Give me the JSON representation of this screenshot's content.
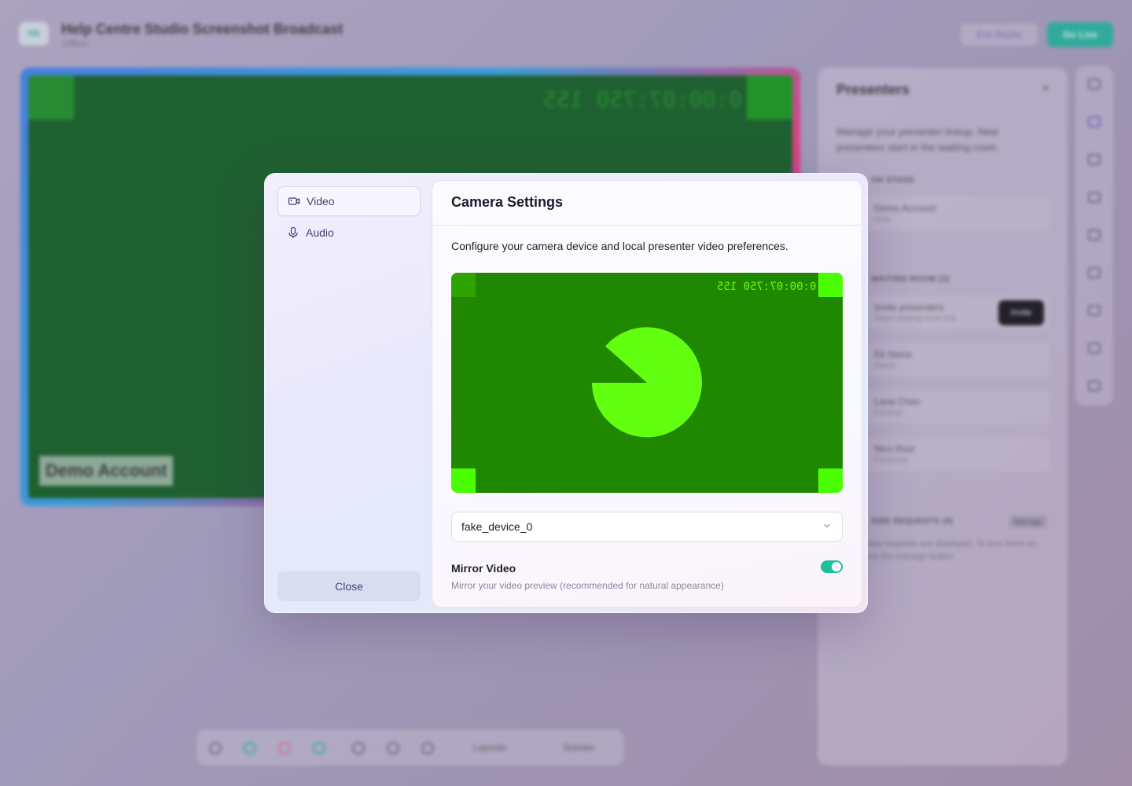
{
  "background": {
    "logo_text": "HS",
    "title": "Help Centre Studio Screenshot Broadcast",
    "subtitle": "Offline",
    "exit_label": "Exit Studio",
    "golive_label": "Go Live",
    "stage_time": "0:00:07:750 155",
    "stage_name": "Demo Account",
    "panel": {
      "title": "Presenters",
      "description": "Manage your presenter lineup. New presenters start in the waiting room.",
      "on_stage_label": "ON STAGE",
      "on_stage_row": {
        "name": "Demo Account",
        "sub": "Host"
      },
      "waiting_label": "WAITING ROOM (3)",
      "invite_row": {
        "name": "Invite presenters",
        "sub": "Share waiting room link"
      },
      "invite_button": "Invite",
      "waiting_rows": [
        {
          "name": "Eli Stone",
          "sub": "Guest"
        },
        {
          "name": "Lana Chen",
          "sub": "Co-host"
        },
        {
          "name": "Nico Ruiz",
          "sub": "Presenter"
        }
      ],
      "requests_label": "SIDE REQUESTS (0)",
      "manage_label": "Manage",
      "requests_note": "New requests are displayed. To turn them on, use the manage button."
    },
    "toolbar": {
      "layouts_label": "Layouts",
      "scenes_label": "Scenes"
    }
  },
  "modal": {
    "nav": [
      {
        "label": "Video",
        "icon": "video-camera-icon",
        "active": true
      },
      {
        "label": "Audio",
        "icon": "microphone-icon",
        "active": false
      }
    ],
    "close_label": "Close",
    "title": "Camera Settings",
    "description": "Configure your camera device and local presenter video preferences.",
    "preview": {
      "timecode": "0:00:07:750 155",
      "background_color": "#208800",
      "shape_color": "#62ff10",
      "corner_top_left_color": "#2fa400",
      "corner_other_color": "#4cff00"
    },
    "device_select": {
      "value": "fake_device_0"
    },
    "mirror": {
      "title": "Mirror Video",
      "description": "Mirror your video preview (recommended for natural appearance)",
      "enabled": true
    },
    "accent_color": "#1fbf9c"
  }
}
